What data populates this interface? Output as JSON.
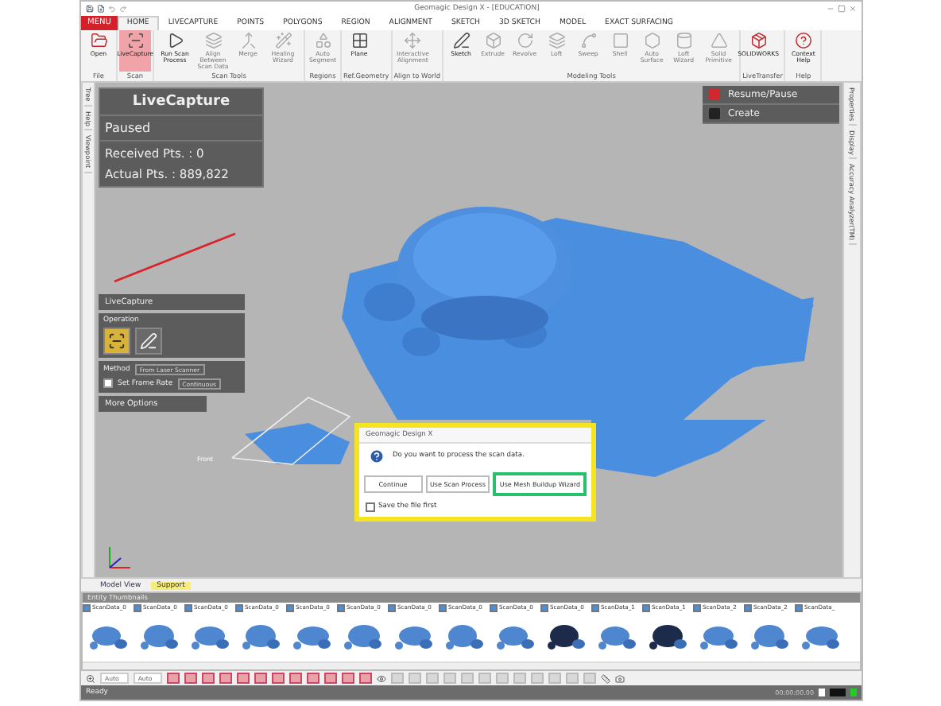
{
  "window": {
    "title": "Geomagic Design X - [EDUCATION]"
  },
  "menu_button": "MENU",
  "tabs": [
    {
      "label": "HOME",
      "selected": true
    },
    {
      "label": "LIVECAPTURE",
      "selected": false
    },
    {
      "label": "POINTS",
      "selected": false
    },
    {
      "label": "POLYGONS",
      "selected": false
    },
    {
      "label": "REGION",
      "selected": false
    },
    {
      "label": "ALIGNMENT",
      "selected": false
    },
    {
      "label": "SKETCH",
      "selected": false
    },
    {
      "label": "3D SKETCH",
      "selected": false
    },
    {
      "label": "MODEL",
      "selected": false
    },
    {
      "label": "EXACT SURFACING",
      "selected": false
    }
  ],
  "ribbon": [
    {
      "label": "File",
      "buttons": [
        {
          "label": "Open",
          "selected": false,
          "disabled": false
        }
      ]
    },
    {
      "label": "Scan",
      "buttons": [
        {
          "label": "LiveCapture",
          "selected": true,
          "disabled": false
        }
      ]
    },
    {
      "label": "Scan Tools",
      "buttons": [
        {
          "label": "Run Scan Process",
          "selected": false,
          "disabled": false
        },
        {
          "label": "Align Between Scan Data",
          "selected": false,
          "disabled": true
        },
        {
          "label": "Merge",
          "selected": false,
          "disabled": true
        },
        {
          "label": "Healing Wizard",
          "selected": false,
          "disabled": true
        }
      ]
    },
    {
      "label": "Regions",
      "buttons": [
        {
          "label": "Auto Segment",
          "selected": false,
          "disabled": true
        }
      ]
    },
    {
      "label": "Ref.Geometry",
      "buttons": [
        {
          "label": "Plane",
          "selected": false,
          "disabled": false
        }
      ]
    },
    {
      "label": "Align to World",
      "buttons": [
        {
          "label": "Interactive Alignment",
          "selected": false,
          "disabled": true
        }
      ]
    },
    {
      "label": "Modeling Tools",
      "buttons": [
        {
          "label": "Sketch",
          "selected": false,
          "disabled": false
        },
        {
          "label": "Extrude",
          "selected": false,
          "disabled": true
        },
        {
          "label": "Revolve",
          "selected": false,
          "disabled": true
        },
        {
          "label": "Loft",
          "selected": false,
          "disabled": true
        },
        {
          "label": "Sweep",
          "selected": false,
          "disabled": true
        },
        {
          "label": "Shell",
          "selected": false,
          "disabled": true
        },
        {
          "label": "Auto Surface",
          "selected": false,
          "disabled": true
        },
        {
          "label": "Loft Wizard",
          "selected": false,
          "disabled": true
        },
        {
          "label": "Solid Primitive",
          "selected": false,
          "disabled": true
        }
      ]
    },
    {
      "label": "LiveTransfer",
      "buttons": [
        {
          "label": "SOLIDWORKS",
          "selected": false,
          "disabled": false
        }
      ]
    },
    {
      "label": "Help",
      "buttons": [
        {
          "label": "Context Help",
          "selected": false,
          "disabled": false
        }
      ]
    }
  ],
  "side_tabs_left": [
    "Tree",
    "Help",
    "Viewpoint"
  ],
  "live_panel": {
    "title": "LiveCapture",
    "status": "Paused",
    "received": "Received Pts. : 0",
    "actual": "Actual Pts. : 889,822"
  },
  "capture_menu": [
    "Resume/Pause",
    "Create"
  ],
  "side_tabs_right": [
    "Properties",
    "Display",
    "Accuracy Analyzer(TM)"
  ],
  "options_panel": {
    "title": "LiveCapture",
    "operation": "Operation",
    "tools": [
      {
        "selected": true
      },
      {
        "selected": false
      }
    ],
    "method_label": "Method",
    "method_value": "From Laser Scanner",
    "frame_rate": {
      "label": "Set Frame Rate",
      "checked": false,
      "value": "Continuous"
    },
    "more": "More Options"
  },
  "plane_label": "Front",
  "dialog": {
    "title": "Geomagic Design X",
    "message": "Do you want to process the scan data.",
    "buttons": [
      {
        "label": "Continue",
        "highlighted": false
      },
      {
        "label": "Use Scan Process",
        "highlighted": false
      },
      {
        "label": "Use Mesh Buildup Wizard",
        "highlighted": true
      }
    ],
    "save_first": {
      "label": "Save the file first",
      "checked": false
    }
  },
  "view_tabs": [
    {
      "label": "Model View",
      "selected": false
    },
    {
      "label": "Support",
      "selected": true
    }
  ],
  "thumbnails": {
    "title": "Entity Thumbnails",
    "items": [
      {
        "label": "ScanData_0",
        "checked": true
      },
      {
        "label": "ScanData_0",
        "checked": true
      },
      {
        "label": "ScanData_0",
        "checked": true
      },
      {
        "label": "ScanData_0",
        "checked": true
      },
      {
        "label": "ScanData_0",
        "checked": true
      },
      {
        "label": "ScanData_0",
        "checked": true
      },
      {
        "label": "ScanData_0",
        "checked": true
      },
      {
        "label": "ScanData_0",
        "checked": true
      },
      {
        "label": "ScanData_0",
        "checked": true
      },
      {
        "label": "ScanData_0",
        "checked": true
      },
      {
        "label": "ScanData_1",
        "checked": true
      },
      {
        "label": "ScanData_1",
        "checked": true
      },
      {
        "label": "ScanData_2",
        "checked": true
      },
      {
        "label": "ScanData_2",
        "checked": true
      },
      {
        "label": "ScanData_",
        "checked": true
      }
    ]
  },
  "toolbar": {
    "fields": [
      "Auto",
      "Auto"
    ]
  },
  "status_bar": {
    "text": "Ready",
    "time": "00:00:00.00"
  }
}
